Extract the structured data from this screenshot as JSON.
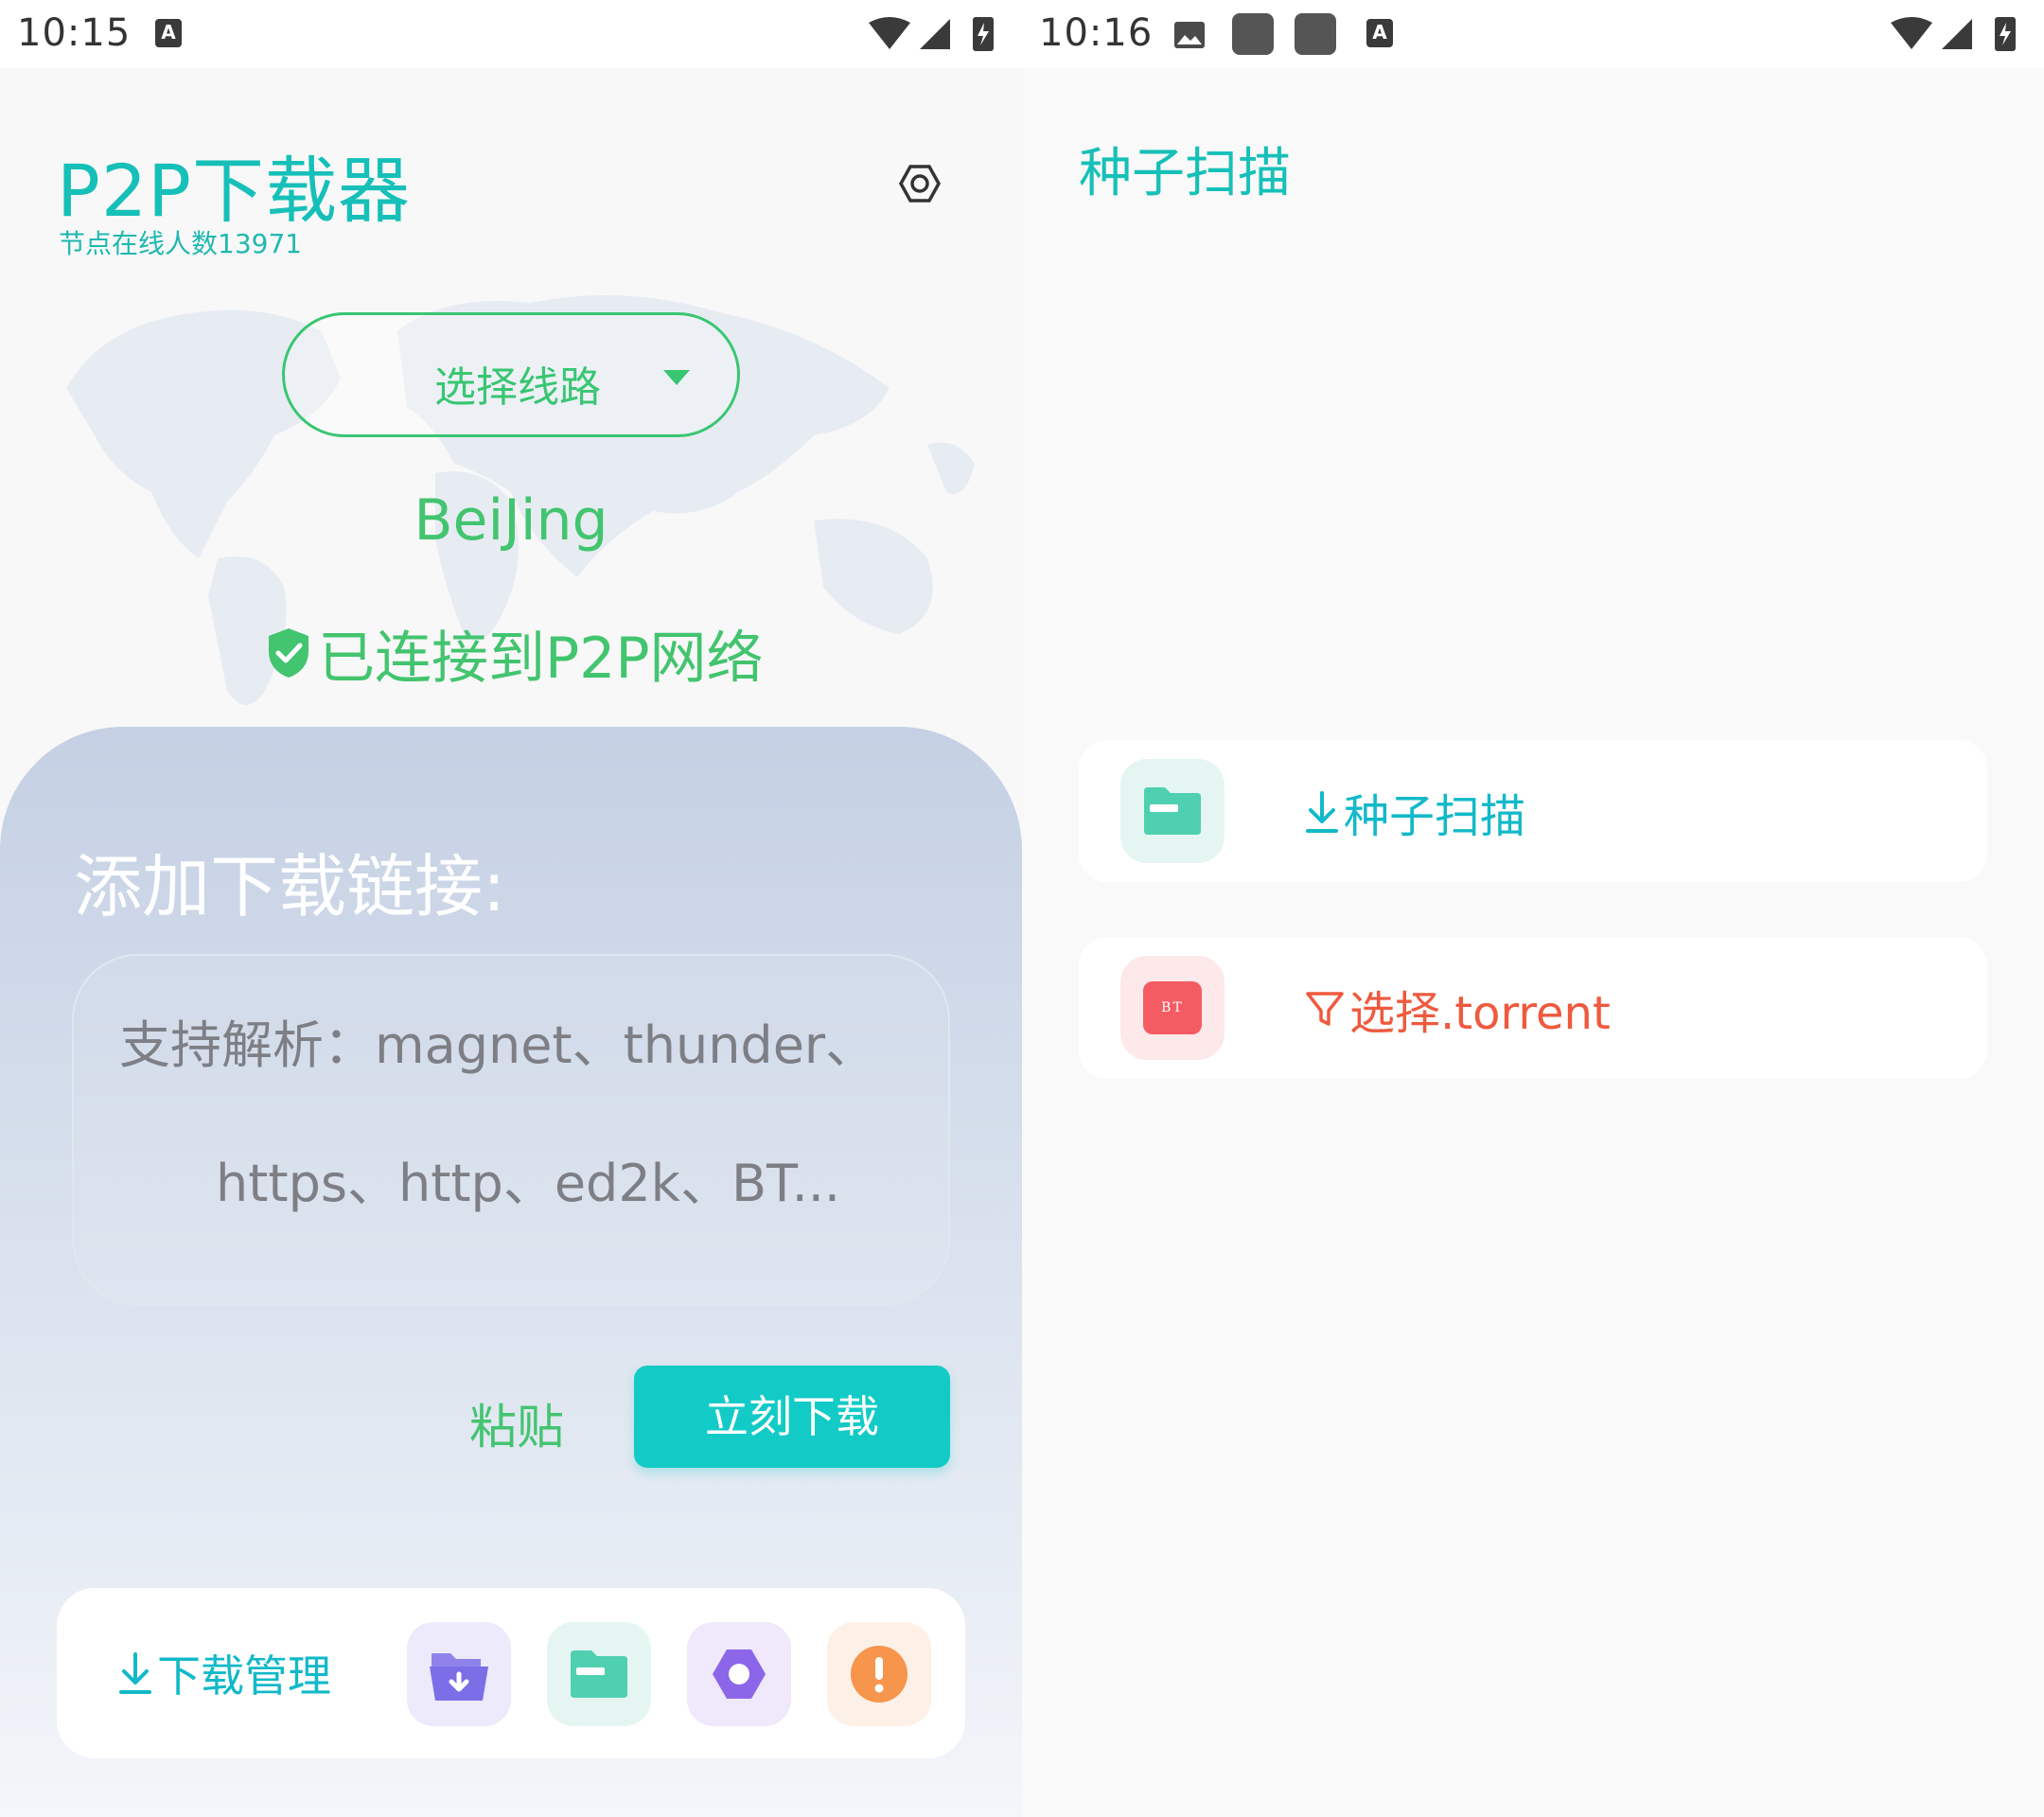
{
  "left": {
    "statusbar": {
      "time": "10:15",
      "keyboard_icon": "A"
    },
    "app": {
      "title": "P2P下载器",
      "online_count": "节点在线人数13971"
    },
    "route": {
      "select_label": "选择线路",
      "city": "BeiJing"
    },
    "connection": {
      "status": "已连接到P2P网络"
    },
    "panel": {
      "title": "添加下载链接:",
      "link_input": {
        "placeholder_line1": "支持解析：magnet、thunder、",
        "placeholder_line2": "https、http、ed2k、BT..."
      },
      "paste_label": "粘贴",
      "download_label": "立刻下载"
    },
    "bottom_bar": {
      "download_manager_label": "下载管理",
      "icons": [
        "folder-download-icon",
        "file-manager-icon",
        "settings-hexagon-icon",
        "warning-icon"
      ]
    }
  },
  "right": {
    "statusbar": {
      "time": "10:16",
      "keyboard_icon": "A"
    },
    "title": "种子扫描",
    "cards": [
      {
        "label": "种子扫描",
        "icon": "folder-icon"
      },
      {
        "label": "选择.torrent",
        "icon": "bt-icon",
        "badge": "BT"
      }
    ]
  },
  "colors": {
    "accent": "#16c0b8",
    "green": "#43c46f",
    "red": "#ee5a3e",
    "button": "#12cbc6"
  }
}
